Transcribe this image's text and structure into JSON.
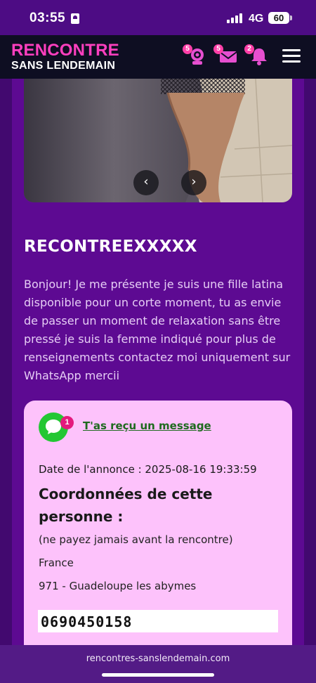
{
  "status_bar": {
    "time": "03:55",
    "network": "4G",
    "battery": "60"
  },
  "header": {
    "brand_line1": "RENCONTRE",
    "brand_line2": "SANS LENDEMAIN",
    "icons": [
      {
        "name": "webcam-icon",
        "badge": "5"
      },
      {
        "name": "mail-icon",
        "badge": "5"
      },
      {
        "name": "bell-icon",
        "badge": "2"
      }
    ],
    "menu_icon": "hamburger-icon"
  },
  "carousel": {
    "prev_icon": "chevron-left-icon",
    "next_icon": "chevron-right-icon",
    "prev_symbol": "‹",
    "next_symbol": "›"
  },
  "ad": {
    "title": "RECONTREEXXXXX",
    "description": "Bonjour! Je me présente je suis une fille latina disponible pour un corte moment, tu as envie de passer un moment de relaxation sans être pressé je suis la femme indiqué pour plus de renseignements contactez moi uniquement sur WhatsApp mercii"
  },
  "card": {
    "message_badge": "1",
    "message_link": "T'as reçu un message",
    "date": "Date de l'annonce : 2025-08-16 19:33:59",
    "heading": "Coordonnées de cette personne :",
    "warning": "(ne payez jamais avant la rencontre)",
    "country": "France",
    "location": "971 - Guadeloupe les abymes",
    "phone": "0690450158"
  },
  "browser": {
    "url": "rencontres-sanslendemain.com"
  },
  "colors": {
    "brand_pink": "#ff3fbf",
    "content_purple": "#5d0a92",
    "card_pink": "#fdc2fb",
    "whatsapp_green": "#23c733",
    "link_green": "#1f6a1f"
  }
}
